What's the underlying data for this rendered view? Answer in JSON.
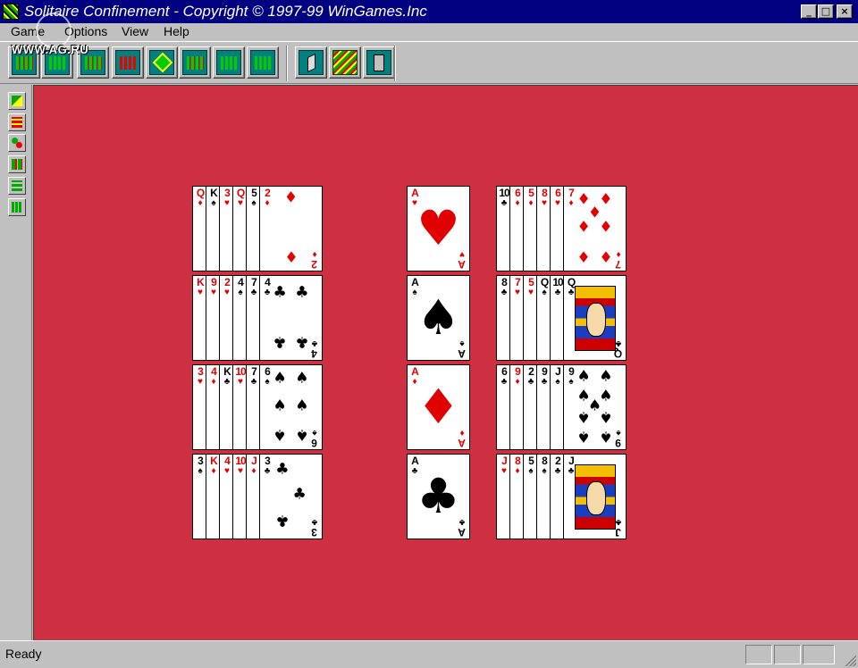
{
  "window": {
    "title": "Solitaire Confinement - Copyright © 1997-99 WinGames.Inc",
    "controls": {
      "minimize": "_",
      "maximize": "□",
      "close": "×"
    }
  },
  "menu": [
    {
      "label": "Game"
    },
    {
      "label": "Options"
    },
    {
      "label": "View"
    },
    {
      "label": "Help"
    }
  ],
  "watermark": "WWW.AG.RU",
  "toolbar": {
    "layout_buttons": [
      {
        "icon": "layout-1-icon"
      },
      {
        "icon": "layout-2-icon"
      },
      {
        "icon": "layout-3-icon"
      },
      {
        "icon": "layout-4-icon"
      },
      {
        "icon": "layout-5-icon"
      },
      {
        "icon": "layout-6-icon"
      },
      {
        "icon": "layout-7-icon"
      },
      {
        "icon": "layout-8-icon"
      }
    ],
    "action_buttons": [
      {
        "icon": "undo-icon"
      },
      {
        "icon": "deck-icon"
      },
      {
        "icon": "exit-icon"
      }
    ]
  },
  "sidebar": [
    {
      "icon": "move-icon"
    },
    {
      "icon": "rows-icon"
    },
    {
      "icon": "hint-icon"
    },
    {
      "icon": "columns-icon"
    },
    {
      "icon": "stack-icon"
    },
    {
      "icon": "stats-icon"
    }
  ],
  "colors": {
    "table": "#cc3041",
    "red_suit": "#e00000",
    "black_suit": "#000000",
    "titlebar": "#000080"
  },
  "status": {
    "text": "Ready"
  },
  "foundations": [
    {
      "rank": "A",
      "suit": "♥",
      "color": "red"
    },
    {
      "rank": "A",
      "suit": "♠",
      "color": "black"
    },
    {
      "rank": "A",
      "suit": "♦",
      "color": "red"
    },
    {
      "rank": "A",
      "suit": "♣",
      "color": "black"
    }
  ],
  "left_rows": [
    {
      "cards": [
        {
          "rank": "Q",
          "suit": "♦",
          "color": "red"
        },
        {
          "rank": "K",
          "suit": "♠",
          "color": "black"
        },
        {
          "rank": "3",
          "suit": "♥",
          "color": "red"
        },
        {
          "rank": "Q",
          "suit": "♥",
          "color": "red"
        },
        {
          "rank": "5",
          "suit": "♠",
          "color": "black"
        },
        {
          "rank": "2",
          "suit": "♦",
          "color": "red"
        }
      ]
    },
    {
      "cards": [
        {
          "rank": "K",
          "suit": "♥",
          "color": "red"
        },
        {
          "rank": "9",
          "suit": "♥",
          "color": "red"
        },
        {
          "rank": "2",
          "suit": "♥",
          "color": "red"
        },
        {
          "rank": "4",
          "suit": "♠",
          "color": "black"
        },
        {
          "rank": "7",
          "suit": "♣",
          "color": "black"
        },
        {
          "rank": "4",
          "suit": "♣",
          "color": "black"
        }
      ]
    },
    {
      "cards": [
        {
          "rank": "3",
          "suit": "♥",
          "color": "red"
        },
        {
          "rank": "4",
          "suit": "♦",
          "color": "red"
        },
        {
          "rank": "K",
          "suit": "♣",
          "color": "black"
        },
        {
          "rank": "10",
          "suit": "♥",
          "color": "red"
        },
        {
          "rank": "7",
          "suit": "♣",
          "color": "black"
        },
        {
          "rank": "6",
          "suit": "♠",
          "color": "black"
        }
      ]
    },
    {
      "cards": [
        {
          "rank": "3",
          "suit": "♠",
          "color": "black"
        },
        {
          "rank": "K",
          "suit": "♦",
          "color": "red"
        },
        {
          "rank": "4",
          "suit": "♥",
          "color": "red"
        },
        {
          "rank": "10",
          "suit": "♥",
          "color": "red"
        },
        {
          "rank": "J",
          "suit": "♦",
          "color": "red"
        },
        {
          "rank": "3",
          "suit": "♣",
          "color": "black"
        }
      ]
    }
  ],
  "right_rows": [
    {
      "cards": [
        {
          "rank": "10",
          "suit": "♣",
          "color": "black"
        },
        {
          "rank": "6",
          "suit": "♦",
          "color": "red"
        },
        {
          "rank": "5",
          "suit": "♦",
          "color": "red"
        },
        {
          "rank": "8",
          "suit": "♥",
          "color": "red"
        },
        {
          "rank": "6",
          "suit": "♥",
          "color": "red"
        },
        {
          "rank": "7",
          "suit": "♦",
          "color": "red"
        }
      ]
    },
    {
      "cards": [
        {
          "rank": "8",
          "suit": "♣",
          "color": "black"
        },
        {
          "rank": "7",
          "suit": "♥",
          "color": "red"
        },
        {
          "rank": "5",
          "suit": "♥",
          "color": "red"
        },
        {
          "rank": "Q",
          "suit": "♠",
          "color": "black"
        },
        {
          "rank": "10",
          "suit": "♣",
          "color": "black"
        },
        {
          "rank": "Q",
          "suit": "♣",
          "color": "black"
        }
      ]
    },
    {
      "cards": [
        {
          "rank": "6",
          "suit": "♣",
          "color": "black"
        },
        {
          "rank": "9",
          "suit": "♦",
          "color": "red"
        },
        {
          "rank": "2",
          "suit": "♣",
          "color": "black"
        },
        {
          "rank": "9",
          "suit": "♣",
          "color": "black"
        },
        {
          "rank": "J",
          "suit": "♠",
          "color": "black"
        },
        {
          "rank": "9",
          "suit": "♠",
          "color": "black"
        }
      ]
    },
    {
      "cards": [
        {
          "rank": "J",
          "suit": "♥",
          "color": "red"
        },
        {
          "rank": "8",
          "suit": "♦",
          "color": "red"
        },
        {
          "rank": "5",
          "suit": "♠",
          "color": "black"
        },
        {
          "rank": "8",
          "suit": "♠",
          "color": "black"
        },
        {
          "rank": "2",
          "suit": "♣",
          "color": "black"
        },
        {
          "rank": "J",
          "suit": "♣",
          "color": "black"
        }
      ]
    }
  ]
}
